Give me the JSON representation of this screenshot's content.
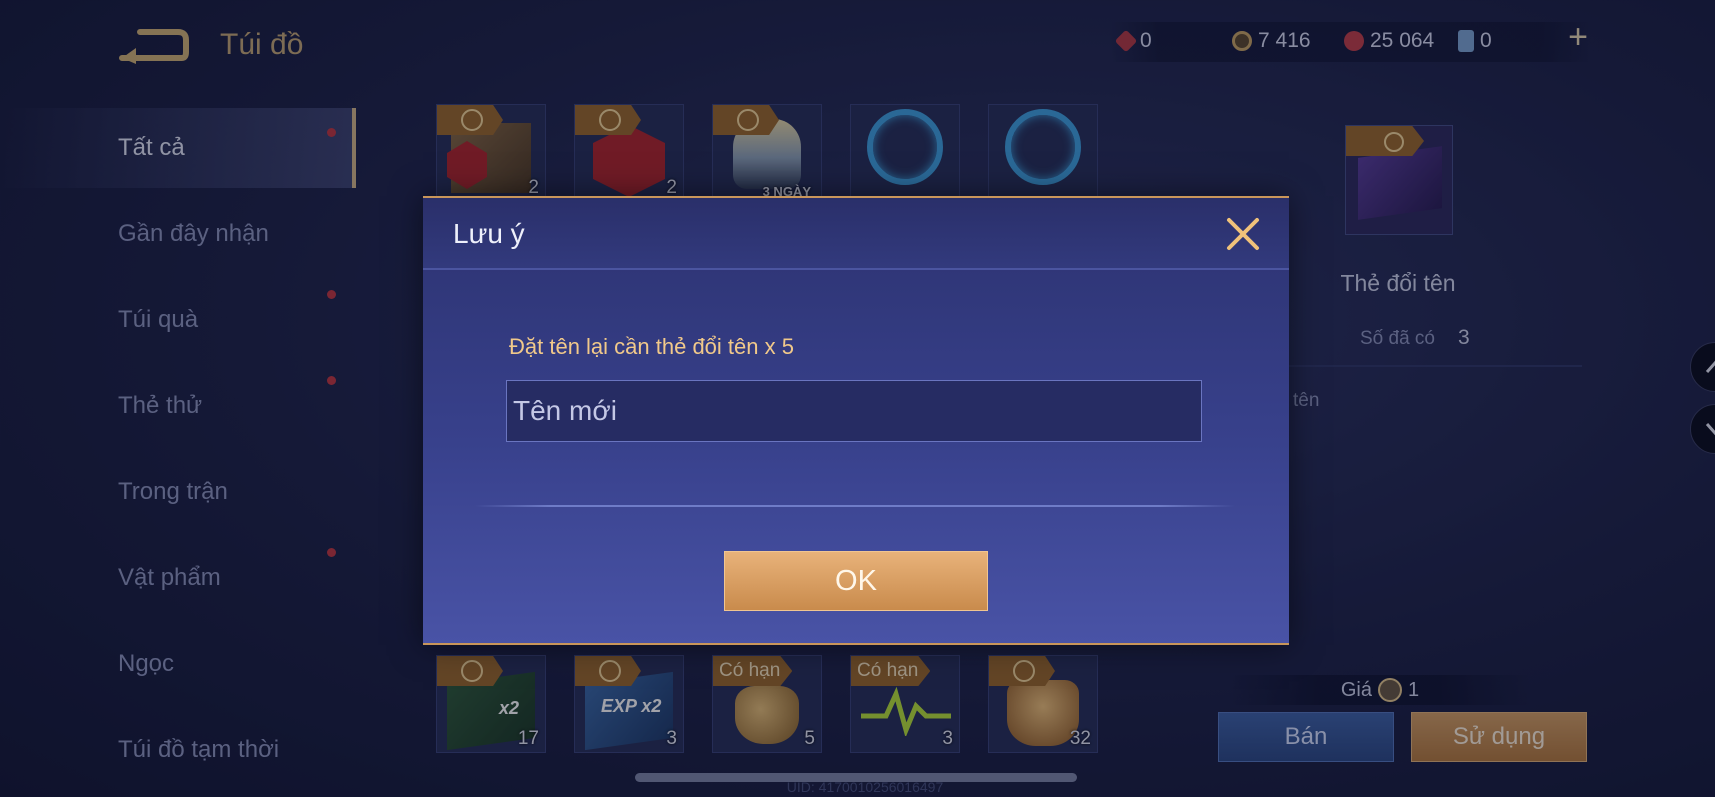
{
  "header": {
    "title": "Túi đồ",
    "back_icon": "back-arrow-icon"
  },
  "currencies": [
    {
      "icon": "ruby-icon",
      "value": "0",
      "color": "#b53a45"
    },
    {
      "icon": "gold-coin-icon",
      "value": "7 416",
      "color": "#c9a565"
    },
    {
      "icon": "red-gem-icon",
      "value": "25 064",
      "color": "#c2404a"
    },
    {
      "icon": "card-icon",
      "value": "0",
      "color": "#7fa7d6"
    }
  ],
  "plus_label": "+",
  "sidebar": {
    "items": [
      {
        "label": "Tất cả",
        "active": true,
        "dot": true
      },
      {
        "label": "Gần đây nhận",
        "active": false,
        "dot": false
      },
      {
        "label": "Túi quà",
        "active": false,
        "dot": true
      },
      {
        "label": "Thẻ thử",
        "active": false,
        "dot": true
      },
      {
        "label": "Trong trận",
        "active": false,
        "dot": false
      },
      {
        "label": "Vật phẩm",
        "active": false,
        "dot": true
      },
      {
        "label": "Ngọc",
        "active": false,
        "dot": false
      },
      {
        "label": "Túi đồ tạm thời",
        "active": false,
        "dot": false
      }
    ]
  },
  "grid_top": [
    {
      "name": "gem-chest-item",
      "count": "2",
      "tag": "coin"
    },
    {
      "name": "red-gem-item",
      "count": "2",
      "tag": "coin"
    },
    {
      "name": "hero-trial-card",
      "count": "",
      "tag": "coin",
      "badge": "3 NGÀY"
    },
    {
      "name": "blue-vortex-item",
      "count": "",
      "tag": ""
    },
    {
      "name": "blue-vortex-item-2",
      "count": "",
      "tag": ""
    }
  ],
  "grid_bottom": [
    {
      "name": "gold-x2-card",
      "count": "17",
      "tag": "coin"
    },
    {
      "name": "exp-x2-card",
      "count": "3",
      "tag": "coin"
    },
    {
      "name": "golden-trophy-item",
      "count": "5",
      "tag": "Có hạn"
    },
    {
      "name": "green-pulse-item",
      "count": "3",
      "tag": "Có hạn"
    },
    {
      "name": "golden-armor-item",
      "count": "32",
      "tag": "coin"
    }
  ],
  "detail": {
    "name": "Thẻ đổi tên",
    "owned_label": "Số đã có",
    "owned_value": "3",
    "desc_fragment": "tên",
    "price_label": "Giá",
    "price_value": "1",
    "sell_label": "Bán",
    "use_label": "Sử dụng"
  },
  "uid_text": "UID: 4170010256016497",
  "dialog": {
    "title": "Lưu ý",
    "notice": "Đặt tên lại cần thẻ đổi tên x 5",
    "input_placeholder": "Tên mới",
    "input_value": "",
    "ok_label": "OK"
  },
  "colors": {
    "accent_gold": "#d6b98a",
    "dialog_bg": "#38418c",
    "notice_text": "#f1c98a",
    "ok_button": "#d49a5e"
  }
}
